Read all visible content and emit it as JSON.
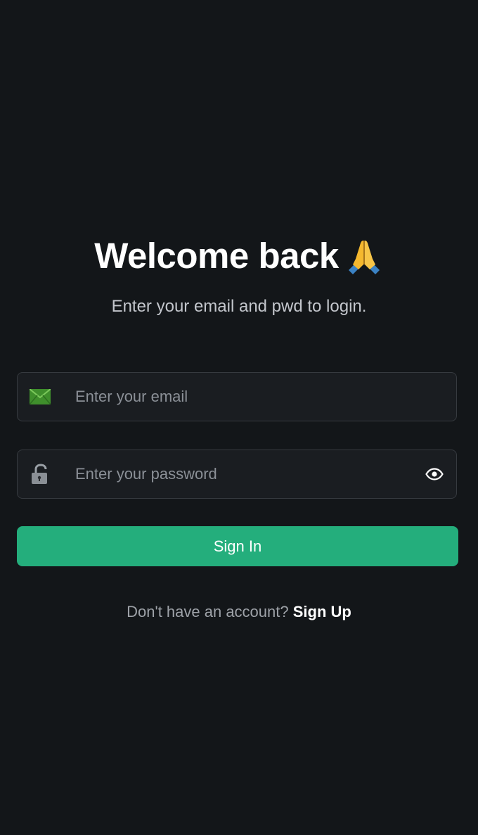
{
  "heading": {
    "title": "Welcome back",
    "icon": "praying-hands-icon"
  },
  "subtitle": "Enter your email and pwd to login.",
  "email_field": {
    "icon": "envelope-icon",
    "value": "",
    "placeholder": "Enter your email"
  },
  "password_field": {
    "icon": "unlocked-padlock-icon",
    "value": "",
    "placeholder": "Enter your password",
    "toggle_icon": "eye-icon"
  },
  "signin_button": {
    "label": "Sign In"
  },
  "footer": {
    "prompt": "Don't have an account?",
    "link_label": "Sign Up"
  },
  "colors": {
    "background": "#131619",
    "field_background": "#1a1d21",
    "field_border": "#363a3f",
    "accent": "#24ae7c",
    "muted_text": "#9ea2a8"
  }
}
